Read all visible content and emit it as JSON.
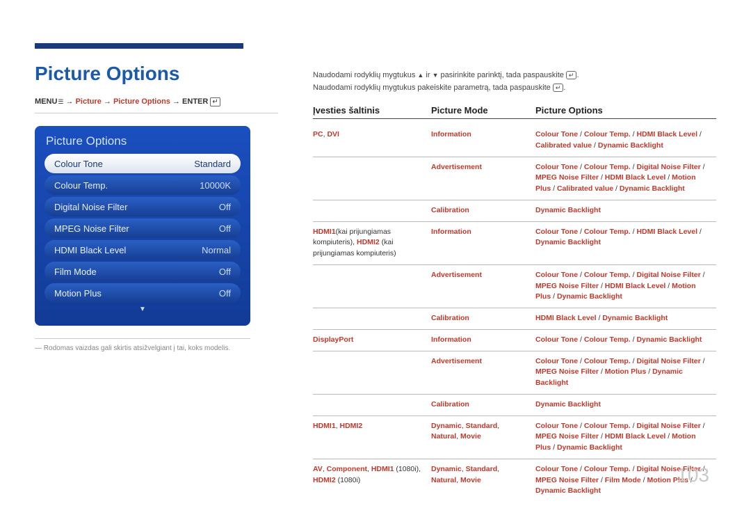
{
  "page_number": "103",
  "title": "Picture Options",
  "breadcrumb": {
    "menu": "MENU",
    "arrow": "→",
    "seg1": "Picture",
    "seg2": "Picture Options",
    "enter": "ENTER"
  },
  "osd": {
    "title": "Picture Options",
    "rows": [
      {
        "label": "Colour Tone",
        "value": "Standard",
        "selected": true
      },
      {
        "label": "Colour Temp.",
        "value": "10000K"
      },
      {
        "label": "Digital Noise Filter",
        "value": "Off"
      },
      {
        "label": "MPEG Noise Filter",
        "value": "Off"
      },
      {
        "label": "HDMI Black Level",
        "value": "Normal"
      },
      {
        "label": "Film Mode",
        "value": "Off"
      },
      {
        "label": "Motion Plus",
        "value": "Off"
      }
    ]
  },
  "note_dash": "―",
  "note": "Rodomas vaizdas gali skirtis atsižvelgiant į tai, koks modelis.",
  "intro_line1_a": "Naudodami rodyklių mygtukus ",
  "intro_line1_b": " ir ",
  "intro_line1_c": " pasirinkite parinktį, tada paspauskite ",
  "intro_line1_d": ".",
  "intro_line2_a": "Naudodami rodyklių mygtukus pakeiskite parametrą, tada paspauskite ",
  "intro_line2_b": ".",
  "table": {
    "headers": {
      "c1": "Įvesties šaltinis",
      "c2": "Picture Mode",
      "c3": "Picture Options"
    },
    "rows": [
      {
        "c1": "<span class='r'>PC</span><span class='k'>, </span><span class='r'>DVI</span>",
        "c2": "<span class='r'>Information</span>",
        "c3": "<span class='r'>Colour Tone</span> / <span class='r'>Colour Temp.</span> / <span class='r'>HDMI Black Level</span> / <span class='r'>Calibrated value</span> / <span class='r'>Dynamic Backlight</span>"
      },
      {
        "c1": "",
        "c2": "<span class='r'>Advertisement</span>",
        "c3": "<span class='r'>Colour Tone</span> / <span class='r'>Colour Temp.</span> / <span class='r'>Digital Noise Filter</span> / <span class='r'>MPEG Noise Filter</span> / <span class='r'>HDMI Black Level</span> / <span class='r'>Motion Plus</span> / <span class='r'>Calibrated value</span> / <span class='r'>Dynamic Backlight</span>"
      },
      {
        "c1": "",
        "c2": "<span class='r'>Calibration</span>",
        "c3": "<span class='r'>Dynamic Backlight</span>"
      },
      {
        "c1": "<span class='r'>HDMI1</span><span class='k'>(kai prijungiamas kompiuteris), </span><span class='r'>HDMI2</span><span class='k'> (kai prijungiamas kompiuteris)</span>",
        "c2": "<span class='r'>Information</span>",
        "c3": "<span class='r'>Colour Tone</span> / <span class='r'>Colour Temp.</span> / <span class='r'>HDMI Black Level</span> / <span class='r'>Dynamic Backlight</span>"
      },
      {
        "c1": "",
        "c2": "<span class='r'>Advertisement</span>",
        "c3": "<span class='r'>Colour Tone</span> / <span class='r'>Colour Temp.</span> / <span class='r'>Digital Noise Filter</span> / <span class='r'>MPEG Noise Filter</span> / <span class='r'>HDMI Black Level</span> / <span class='r'>Motion Plus</span> / <span class='r'>Dynamic Backlight</span>"
      },
      {
        "c1": "",
        "c2": "<span class='r'>Calibration</span>",
        "c3": "<span class='r'>HDMI Black Level</span> / <span class='r'>Dynamic Backlight</span>"
      },
      {
        "c1": "<span class='r'>DisplayPort</span>",
        "c2": "<span class='r'>Information</span>",
        "c3": "<span class='r'>Colour Tone</span> / <span class='r'>Colour Temp.</span> / <span class='r'>Dynamic Backlight</span>"
      },
      {
        "c1": "",
        "c2": "<span class='r'>Advertisement</span>",
        "c3": "<span class='r'>Colour Tone</span> / <span class='r'>Colour Temp.</span> / <span class='r'>Digital Noise Filter</span> / <span class='r'>MPEG Noise Filter</span> / <span class='r'>Motion Plus</span> / <span class='r'>Dynamic Backlight</span>"
      },
      {
        "c1": "",
        "c2": "<span class='r'>Calibration</span>",
        "c3": "<span class='r'>Dynamic Backlight</span>"
      },
      {
        "c1": "<span class='r'>HDMI1</span><span class='k'>, </span><span class='r'>HDMI2</span>",
        "c2": "<span class='r'>Dynamic</span><span class='k'>, </span><span class='r'>Standard</span><span class='k'>, </span><span class='r'>Natural</span><span class='k'>, </span><span class='r'>Movie</span>",
        "c3": "<span class='r'>Colour Tone</span> / <span class='r'>Colour Temp.</span> / <span class='r'>Digital Noise Filter</span> / <span class='r'>MPEG Noise Filter</span> / <span class='r'>HDMI Black Level</span> / <span class='r'>Motion Plus</span> / <span class='r'>Dynamic Backlight</span>"
      },
      {
        "c1": "<span class='r'>AV</span><span class='k'>, </span><span class='r'>Component</span><span class='k'>, </span><span class='r'>HDMI1</span><span class='k'> (1080i), </span><span class='r'>HDMI2</span><span class='k'> (1080i)</span>",
        "c2": "<span class='r'>Dynamic</span><span class='k'>, </span><span class='r'>Standard</span><span class='k'>, </span><span class='r'>Natural</span><span class='k'>, </span><span class='r'>Movie</span>",
        "c3": "<span class='r'>Colour Tone</span> / <span class='r'>Colour Temp.</span> / <span class='r'>Digital Noise Filter</span> / <span class='r'>MPEG Noise Filter</span> / <span class='r'>Film Mode</span> / <span class='r'>Motion Plus</span> / <span class='r'>Dynamic Backlight</span>"
      }
    ]
  }
}
